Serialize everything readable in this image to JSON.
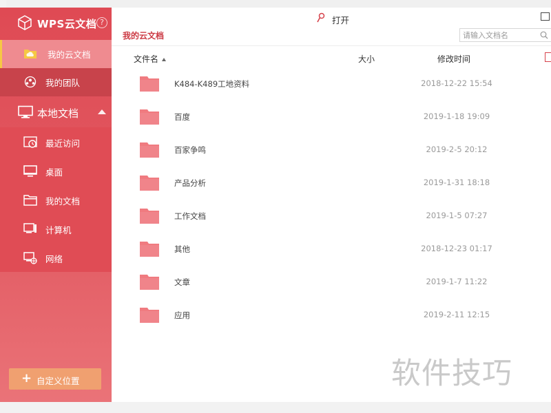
{
  "app": {
    "brand": "WPS云文档",
    "help": "?"
  },
  "sidebar": {
    "cloud_items": [
      {
        "label": "我的云文档",
        "icon": "cloud-folder-icon",
        "selected": true
      },
      {
        "label": "我的团队",
        "icon": "team-icon",
        "selected": false
      }
    ],
    "local_header": "本地文档",
    "local_items": [
      {
        "label": "最近访问",
        "icon": "recent-icon"
      },
      {
        "label": "桌面",
        "icon": "desktop-icon"
      },
      {
        "label": "我的文档",
        "icon": "documents-folder-icon"
      },
      {
        "label": "计算机",
        "icon": "computer-icon"
      },
      {
        "label": "网络",
        "icon": "network-icon"
      }
    ],
    "custom_location": "自定义位置"
  },
  "toolbar": {
    "open_label": "打开"
  },
  "main": {
    "breadcrumb": "我的云文档",
    "search_placeholder": "请输入文档名",
    "columns": {
      "name": "文件名",
      "size": "大小",
      "mtime": "修改时间"
    },
    "files": [
      {
        "name": "K484-K489工地资料",
        "mtime": "2018-12-22 15:54"
      },
      {
        "name": "百度",
        "mtime": "2019-1-18 19:09"
      },
      {
        "name": "百家争鸣",
        "mtime": "2019-2-5 20:12"
      },
      {
        "name": "产品分析",
        "mtime": "2019-1-31 18:18"
      },
      {
        "name": "工作文档",
        "mtime": "2019-1-5 07:27"
      },
      {
        "name": "其他",
        "mtime": "2018-12-23 01:17"
      },
      {
        "name": "文章",
        "mtime": "2019-1-7 11:22"
      },
      {
        "name": "应用",
        "mtime": "2019-2-11 12:15"
      }
    ]
  },
  "watermark": "软件技巧",
  "colors": {
    "accent": "#df4a54",
    "folder": "#f07b80",
    "selected_marker": "#f6c844",
    "custom_button": "#f0a070"
  }
}
